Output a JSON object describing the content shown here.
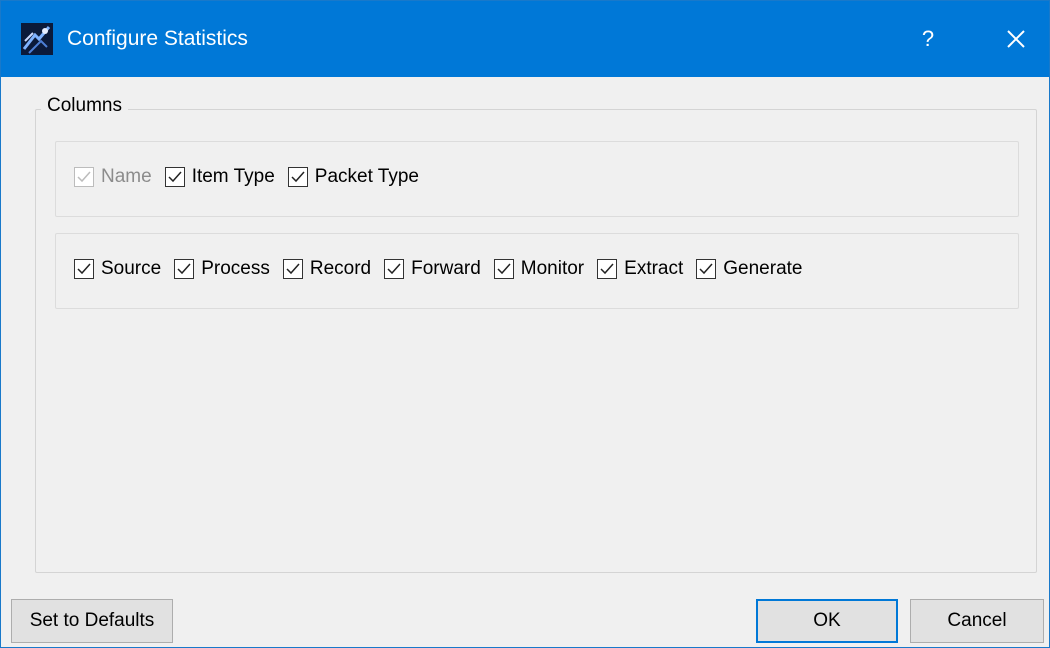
{
  "window": {
    "title": "Configure Statistics",
    "app_icon": "app-logo-icon",
    "help_label": "?",
    "close_icon": "close-icon",
    "titlebar_color": "#0078d7"
  },
  "columns_group": {
    "title": "Columns",
    "row1": [
      {
        "label": "Name",
        "checked": true,
        "enabled": false
      },
      {
        "label": "Item Type",
        "checked": true,
        "enabled": true
      },
      {
        "label": "Packet Type",
        "checked": true,
        "enabled": true
      }
    ],
    "row2": [
      {
        "label": "Source",
        "checked": true,
        "enabled": true
      },
      {
        "label": "Process",
        "checked": true,
        "enabled": true
      },
      {
        "label": "Record",
        "checked": true,
        "enabled": true
      },
      {
        "label": "Forward",
        "checked": true,
        "enabled": true
      },
      {
        "label": "Monitor",
        "checked": true,
        "enabled": true
      },
      {
        "label": "Extract",
        "checked": true,
        "enabled": true
      },
      {
        "label": "Generate",
        "checked": true,
        "enabled": true
      }
    ]
  },
  "buttons": {
    "defaults": "Set to Defaults",
    "ok": "OK",
    "cancel": "Cancel"
  }
}
